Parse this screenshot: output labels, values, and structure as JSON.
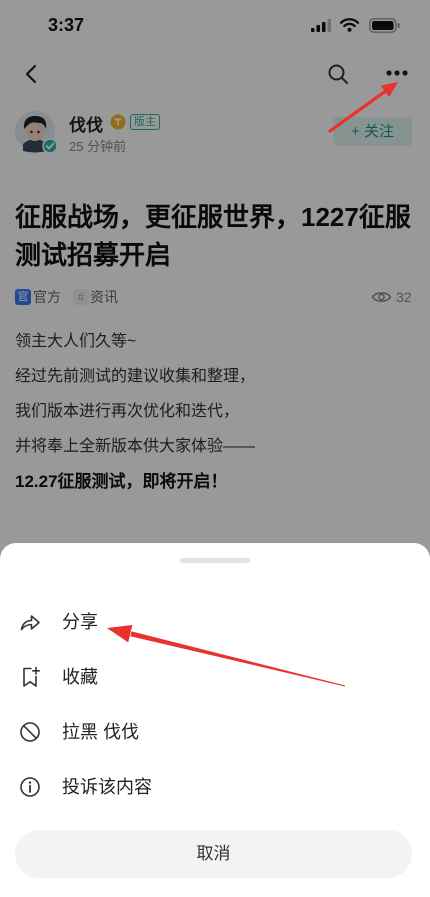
{
  "status_bar": {
    "time": "3:37",
    "icons": [
      "signal-icon",
      "wifi-icon",
      "battery-icon"
    ]
  },
  "nav": {
    "icons": [
      "chevron-left-icon",
      "search-icon",
      "more-dots-icon"
    ]
  },
  "author": {
    "name": "伐伐",
    "role": "版主",
    "time": "25 分钟前",
    "follow_label": "+ 关注"
  },
  "post": {
    "title": "征服战场，更征服世界，1227征服测试招募开启",
    "tags": [
      {
        "badge": "官",
        "label": "官方"
      },
      {
        "badge": "#",
        "label": "资讯"
      }
    ],
    "views": "32",
    "body": [
      "领主大人们久等~",
      "经过先前测试的建议收集和整理，",
      "我们版本进行再次优化和迭代，",
      "并将奉上全新版本供大家体验——",
      "12.27征服测试，即将开启！"
    ]
  },
  "sheet": {
    "items": [
      {
        "label": "分享",
        "icon": "share-icon"
      },
      {
        "label": "收藏",
        "icon": "bookmark-add-icon"
      },
      {
        "label": "拉黑 伐伐",
        "icon": "block-icon"
      },
      {
        "label": "投诉该内容",
        "icon": "info-icon"
      }
    ],
    "cancel_label": "取消"
  },
  "colors": {
    "accent": "#139a8b",
    "role_tag": "#2cb39a",
    "official_badge": "#3a7ef5",
    "overlay": "rgba(0,0,0,0.4)",
    "annotation": "#e8322c"
  }
}
